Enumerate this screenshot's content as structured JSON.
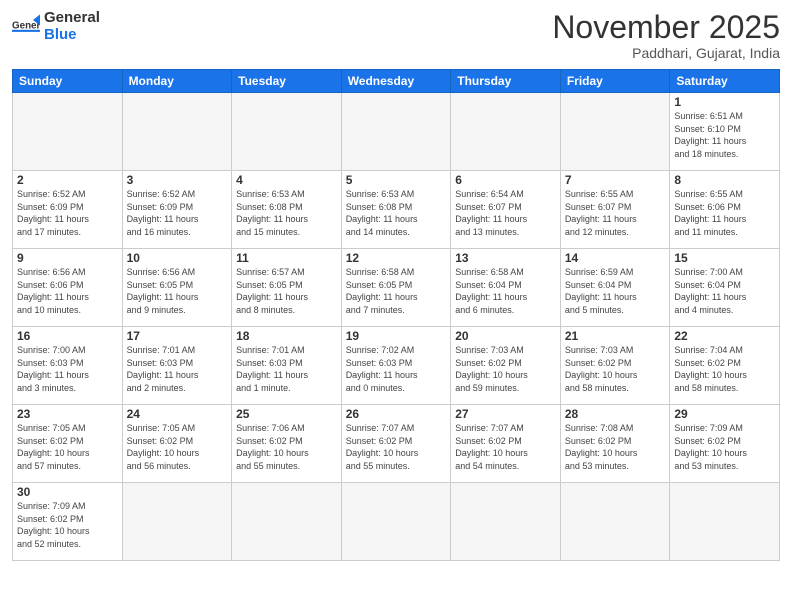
{
  "logo": {
    "text_general": "General",
    "text_blue": "Blue"
  },
  "title": "November 2025",
  "location": "Paddhari, Gujarat, India",
  "days_of_week": [
    "Sunday",
    "Monday",
    "Tuesday",
    "Wednesday",
    "Thursday",
    "Friday",
    "Saturday"
  ],
  "weeks": [
    [
      {
        "day": "",
        "info": ""
      },
      {
        "day": "",
        "info": ""
      },
      {
        "day": "",
        "info": ""
      },
      {
        "day": "",
        "info": ""
      },
      {
        "day": "",
        "info": ""
      },
      {
        "day": "",
        "info": ""
      },
      {
        "day": "1",
        "info": "Sunrise: 6:51 AM\nSunset: 6:10 PM\nDaylight: 11 hours\nand 18 minutes."
      }
    ],
    [
      {
        "day": "2",
        "info": "Sunrise: 6:52 AM\nSunset: 6:09 PM\nDaylight: 11 hours\nand 17 minutes."
      },
      {
        "day": "3",
        "info": "Sunrise: 6:52 AM\nSunset: 6:09 PM\nDaylight: 11 hours\nand 16 minutes."
      },
      {
        "day": "4",
        "info": "Sunrise: 6:53 AM\nSunset: 6:08 PM\nDaylight: 11 hours\nand 15 minutes."
      },
      {
        "day": "5",
        "info": "Sunrise: 6:53 AM\nSunset: 6:08 PM\nDaylight: 11 hours\nand 14 minutes."
      },
      {
        "day": "6",
        "info": "Sunrise: 6:54 AM\nSunset: 6:07 PM\nDaylight: 11 hours\nand 13 minutes."
      },
      {
        "day": "7",
        "info": "Sunrise: 6:55 AM\nSunset: 6:07 PM\nDaylight: 11 hours\nand 12 minutes."
      },
      {
        "day": "8",
        "info": "Sunrise: 6:55 AM\nSunset: 6:06 PM\nDaylight: 11 hours\nand 11 minutes."
      }
    ],
    [
      {
        "day": "9",
        "info": "Sunrise: 6:56 AM\nSunset: 6:06 PM\nDaylight: 11 hours\nand 10 minutes."
      },
      {
        "day": "10",
        "info": "Sunrise: 6:56 AM\nSunset: 6:05 PM\nDaylight: 11 hours\nand 9 minutes."
      },
      {
        "day": "11",
        "info": "Sunrise: 6:57 AM\nSunset: 6:05 PM\nDaylight: 11 hours\nand 8 minutes."
      },
      {
        "day": "12",
        "info": "Sunrise: 6:58 AM\nSunset: 6:05 PM\nDaylight: 11 hours\nand 7 minutes."
      },
      {
        "day": "13",
        "info": "Sunrise: 6:58 AM\nSunset: 6:04 PM\nDaylight: 11 hours\nand 6 minutes."
      },
      {
        "day": "14",
        "info": "Sunrise: 6:59 AM\nSunset: 6:04 PM\nDaylight: 11 hours\nand 5 minutes."
      },
      {
        "day": "15",
        "info": "Sunrise: 7:00 AM\nSunset: 6:04 PM\nDaylight: 11 hours\nand 4 minutes."
      }
    ],
    [
      {
        "day": "16",
        "info": "Sunrise: 7:00 AM\nSunset: 6:03 PM\nDaylight: 11 hours\nand 3 minutes."
      },
      {
        "day": "17",
        "info": "Sunrise: 7:01 AM\nSunset: 6:03 PM\nDaylight: 11 hours\nand 2 minutes."
      },
      {
        "day": "18",
        "info": "Sunrise: 7:01 AM\nSunset: 6:03 PM\nDaylight: 11 hours\nand 1 minute."
      },
      {
        "day": "19",
        "info": "Sunrise: 7:02 AM\nSunset: 6:03 PM\nDaylight: 11 hours\nand 0 minutes."
      },
      {
        "day": "20",
        "info": "Sunrise: 7:03 AM\nSunset: 6:02 PM\nDaylight: 10 hours\nand 59 minutes."
      },
      {
        "day": "21",
        "info": "Sunrise: 7:03 AM\nSunset: 6:02 PM\nDaylight: 10 hours\nand 58 minutes."
      },
      {
        "day": "22",
        "info": "Sunrise: 7:04 AM\nSunset: 6:02 PM\nDaylight: 10 hours\nand 58 minutes."
      }
    ],
    [
      {
        "day": "23",
        "info": "Sunrise: 7:05 AM\nSunset: 6:02 PM\nDaylight: 10 hours\nand 57 minutes."
      },
      {
        "day": "24",
        "info": "Sunrise: 7:05 AM\nSunset: 6:02 PM\nDaylight: 10 hours\nand 56 minutes."
      },
      {
        "day": "25",
        "info": "Sunrise: 7:06 AM\nSunset: 6:02 PM\nDaylight: 10 hours\nand 55 minutes."
      },
      {
        "day": "26",
        "info": "Sunrise: 7:07 AM\nSunset: 6:02 PM\nDaylight: 10 hours\nand 55 minutes."
      },
      {
        "day": "27",
        "info": "Sunrise: 7:07 AM\nSunset: 6:02 PM\nDaylight: 10 hours\nand 54 minutes."
      },
      {
        "day": "28",
        "info": "Sunrise: 7:08 AM\nSunset: 6:02 PM\nDaylight: 10 hours\nand 53 minutes."
      },
      {
        "day": "29",
        "info": "Sunrise: 7:09 AM\nSunset: 6:02 PM\nDaylight: 10 hours\nand 53 minutes."
      }
    ],
    [
      {
        "day": "30",
        "info": "Sunrise: 7:09 AM\nSunset: 6:02 PM\nDaylight: 10 hours\nand 52 minutes."
      },
      {
        "day": "",
        "info": ""
      },
      {
        "day": "",
        "info": ""
      },
      {
        "day": "",
        "info": ""
      },
      {
        "day": "",
        "info": ""
      },
      {
        "day": "",
        "info": ""
      },
      {
        "day": "",
        "info": ""
      }
    ]
  ]
}
